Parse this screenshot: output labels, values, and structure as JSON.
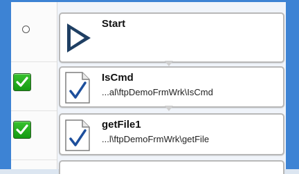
{
  "steps": [
    {
      "title": "Start",
      "icon": "play-icon",
      "checked": null
    },
    {
      "title": "IsCmd",
      "path": "...al\\ftpDemoFrmWrk\\IsCmd",
      "icon": "document-check-icon",
      "checked": true
    },
    {
      "title": "getFile1",
      "path": "...l\\ftpDemoFrmWrk\\getFile",
      "icon": "document-check-icon",
      "checked": true
    }
  ]
}
